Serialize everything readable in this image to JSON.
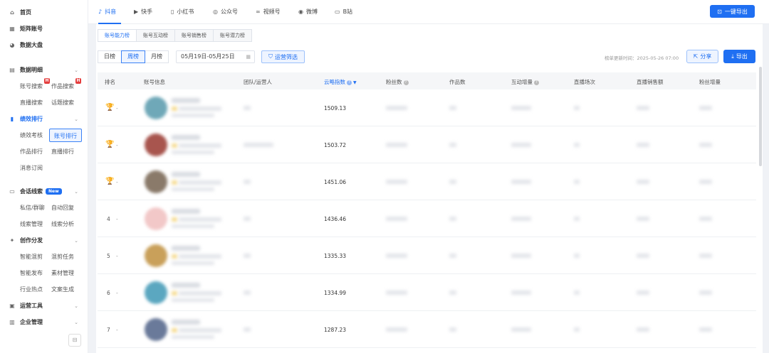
{
  "sidebar": {
    "top_items": [
      {
        "label": "首页",
        "icon": "home-icon"
      },
      {
        "label": "矩阵账号",
        "icon": "grid-icon"
      },
      {
        "label": "数据大盘",
        "icon": "pie-chart-icon"
      }
    ],
    "groups": {
      "data_detail": "数据明细",
      "performance_rank": "绩效排行",
      "conversation_leads": "会话线索",
      "new_badge": "New",
      "creation_distribution": "创作分发",
      "operation_tools": "运营工具",
      "enterprise_mgmt": "企业管理"
    },
    "subs": {
      "account_search": "账号搜索",
      "works_search": "作品搜索",
      "live_search": "直播搜索",
      "topic_search": "话题搜索",
      "perf_review": "绩效考核",
      "account_rank": "账号排行",
      "works_rank": "作品排行",
      "live_rank": "直播排行",
      "msg_subscribe": "消息订阅",
      "private_group": "私信/群聊",
      "auto_reply": "自动回复",
      "lead_mgmt": "线索管理",
      "lead_analysis": "线索分析",
      "smart_mix": "智能混剪",
      "mix_task": "混剪任务",
      "smart_publish": "智能发布",
      "material_mgmt": "素材管理",
      "industry_hot": "行业热点",
      "copy_gen": "文案生成"
    },
    "h_badge": "H"
  },
  "platforms": [
    {
      "label": "抖音",
      "icon": "douyin-icon"
    },
    {
      "label": "快手",
      "icon": "kuaishou-icon"
    },
    {
      "label": "小红书",
      "icon": "xiaohongshu-icon"
    },
    {
      "label": "公众号",
      "icon": "wechat-official-icon"
    },
    {
      "label": "视频号",
      "icon": "channels-icon"
    },
    {
      "label": "微博",
      "icon": "weibo-icon"
    },
    {
      "label": "B站",
      "icon": "bilibili-icon"
    }
  ],
  "export_all": "一键导出",
  "rank_tabs": [
    "账号能力榜",
    "账号互动榜",
    "账号销售榜",
    "账号潜力榜"
  ],
  "period_tabs": [
    "日榜",
    "周榜",
    "月榜"
  ],
  "date_range": "05月19日-05月25日",
  "filter_button": "运营筛选",
  "update_time": "榜单更新时间：2025-05-26 07:00",
  "share_button": "分享",
  "export_button": "导出",
  "columns": [
    "排名",
    "账号信息",
    "团队/运营人",
    "云略指数",
    "粉丝数",
    "作品数",
    "互动增量",
    "直播场次",
    "直播销售额",
    "粉丝增量"
  ],
  "rows": [
    {
      "rank": "1",
      "medal": "gold",
      "index": "1509.13"
    },
    {
      "rank": "2",
      "medal": "silver",
      "index": "1503.72"
    },
    {
      "rank": "3",
      "medal": "bronze",
      "index": "1451.06"
    },
    {
      "rank": "4",
      "medal": "",
      "index": "1436.46"
    },
    {
      "rank": "5",
      "medal": "",
      "index": "1335.33"
    },
    {
      "rank": "6",
      "medal": "",
      "index": "1334.99"
    },
    {
      "rank": "7",
      "medal": "",
      "index": "1287.23"
    }
  ],
  "rank_dash": "-",
  "colors": {
    "accent": "#1f6ff2",
    "gold": "#d4a017",
    "silver": "#9ea3ab",
    "bronze": "#c58a3b"
  }
}
